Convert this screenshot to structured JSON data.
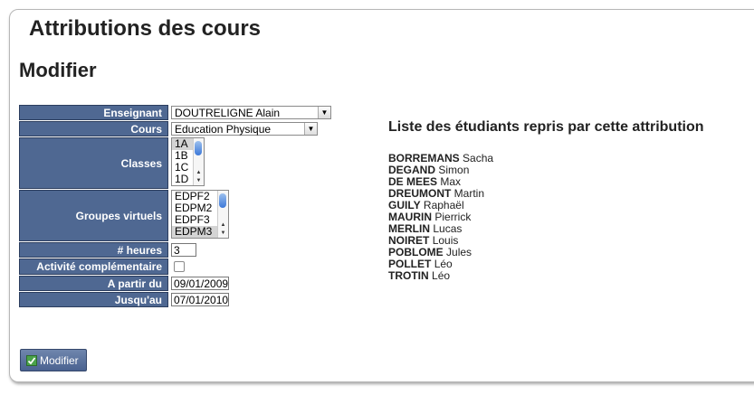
{
  "page": {
    "title": "Attributions des cours",
    "subtitle": "Modifier"
  },
  "form": {
    "enseignant": {
      "label": "Enseignant",
      "value": "DOUTRELIGNE Alain"
    },
    "cours": {
      "label": "Cours",
      "value": "Education Physique"
    },
    "classes": {
      "label": "Classes",
      "options": [
        "1A",
        "1B",
        "1C",
        "1D"
      ],
      "selected": "1A"
    },
    "groupes": {
      "label": "Groupes virtuels",
      "options": [
        "EDPF2",
        "EDPM2",
        "EDPF3",
        "EDPM3"
      ],
      "selected": "EDPM3"
    },
    "heures": {
      "label": "# heures",
      "value": "3"
    },
    "activite": {
      "label": "Activité complémentaire",
      "checked": false
    },
    "a_partir": {
      "label": "A partir du",
      "value": "09/01/2009"
    },
    "jusqu": {
      "label": "Jusqu'au",
      "value": "07/01/2010"
    }
  },
  "students_panel": {
    "title": "Liste des étudiants repris par cette attribution",
    "students": [
      {
        "last": "BORREMANS",
        "first": "Sacha"
      },
      {
        "last": "DEGAND",
        "first": "Simon"
      },
      {
        "last": "DE MEES",
        "first": "Max"
      },
      {
        "last": "DREUMONT",
        "first": "Martin"
      },
      {
        "last": "GUILY",
        "first": "Raphaël"
      },
      {
        "last": "MAURIN",
        "first": "Pierrick"
      },
      {
        "last": "MERLIN",
        "first": "Lucas"
      },
      {
        "last": "NOIRET",
        "first": "Louis"
      },
      {
        "last": "POBLOME",
        "first": "Jules"
      },
      {
        "last": "POLLET",
        "first": "Léo"
      },
      {
        "last": "TROTIN",
        "first": "Léo"
      }
    ]
  },
  "button": {
    "label": "Modifier",
    "icon": "check-icon"
  },
  "colors": {
    "label_bg": "#4f6892",
    "button_bg": "#5a729c"
  }
}
